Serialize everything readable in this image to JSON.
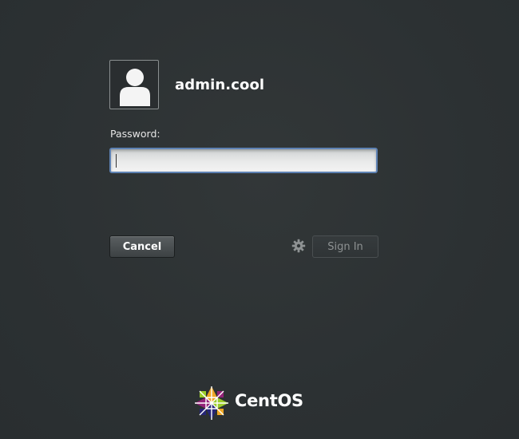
{
  "login": {
    "username": "admin.cool",
    "password_label": "Password:",
    "password_value": "",
    "cancel_label": "Cancel",
    "signin_label": "Sign In"
  },
  "icons": {
    "avatar": "user-silhouette-icon",
    "session_options": "gear-icon",
    "brand_logo": "centos-logo"
  },
  "branding": {
    "logo_text": "CentOS"
  },
  "colors": {
    "background": "#2e3436",
    "input_focus_border": "#5e82b4",
    "text_primary": "#ffffff",
    "signin_disabled_text": "#8e9293"
  }
}
